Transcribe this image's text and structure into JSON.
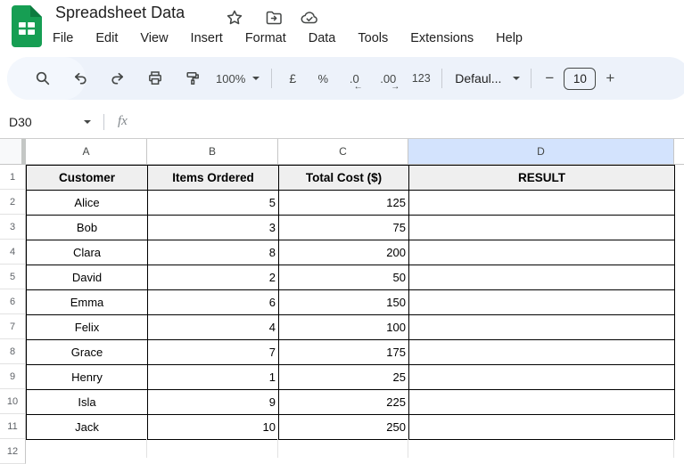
{
  "header": {
    "title": "Spreadsheet Data",
    "menus": [
      "File",
      "Edit",
      "View",
      "Insert",
      "Format",
      "Data",
      "Tools",
      "Extensions",
      "Help"
    ]
  },
  "toolbar": {
    "zoom_value": "100%",
    "currency": "£",
    "percent": "%",
    "decrease_decimal": ".0",
    "decrease_decimal_arrow": "←",
    "increase_decimal": ".00",
    "increase_decimal_arrow": "→",
    "more_formats": "123",
    "font_family_value": "Defaul...",
    "decrease_font_size": "−",
    "font_size_value": "10",
    "increase_font_size": "+"
  },
  "formula_bar": {
    "cell_reference": "D30",
    "fx": "fx"
  },
  "grid": {
    "column_headers": [
      "A",
      "B",
      "C",
      "D"
    ],
    "selected_column_index": 3,
    "visible_rows": [
      "1",
      "2",
      "3",
      "4",
      "5",
      "6",
      "7",
      "8",
      "9",
      "10",
      "11",
      "12"
    ],
    "table": {
      "columns": [
        "Customer",
        "Items Ordered",
        "Total Cost ($)",
        "RESULT"
      ],
      "rows": [
        [
          "Alice",
          "5",
          "125",
          ""
        ],
        [
          "Bob",
          "3",
          "75",
          ""
        ],
        [
          "Clara",
          "8",
          "200",
          ""
        ],
        [
          "David",
          "2",
          "50",
          ""
        ],
        [
          "Emma",
          "6",
          "150",
          ""
        ],
        [
          "Felix",
          "4",
          "100",
          ""
        ],
        [
          "Grace",
          "7",
          "175",
          ""
        ],
        [
          "Henry",
          "1",
          "25",
          ""
        ],
        [
          "Isla",
          "9",
          "225",
          ""
        ],
        [
          "Jack",
          "10",
          "250",
          ""
        ]
      ]
    }
  },
  "colors": {
    "toolbar_bg": "#edf2fa",
    "selected_column_header_bg": "#d3e3fd",
    "table_header_bg": "#efefef",
    "brand_green": "#169e53",
    "icon_gray": "#444746"
  }
}
